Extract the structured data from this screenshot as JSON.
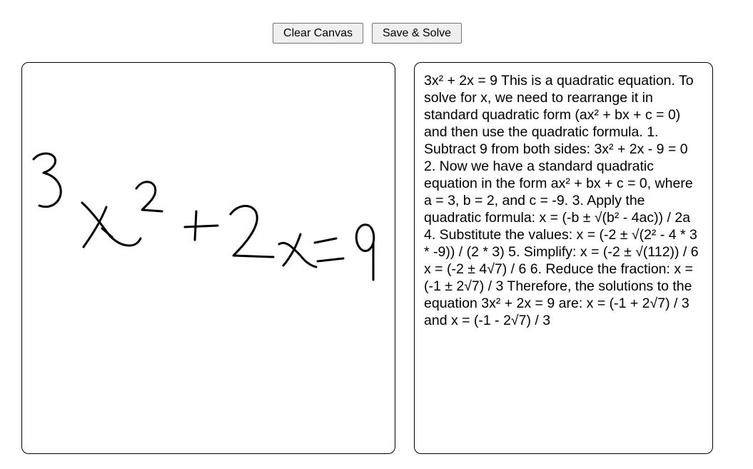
{
  "toolbar": {
    "clear_label": "Clear Canvas",
    "save_label": "Save & Solve"
  },
  "canvas": {
    "stroke_color": "#000000"
  },
  "result": {
    "text": "3x² + 2x = 9 This is a quadratic equation. To solve for x, we need to rearrange it in standard quadratic form (ax² + bx + c = 0) and then use the quadratic formula. 1. Subtract 9 from both sides: 3x² + 2x - 9 = 0 2. Now we have a standard quadratic equation in the form ax² + bx + c = 0, where a = 3, b = 2, and c = -9. 3. Apply the quadratic formula: x = (-b ± √(b² - 4ac)) / 2a 4. Substitute the values: x = (-2 ± √(2² - 4 * 3 * -9)) / (2 * 3) 5. Simplify: x = (-2 ± √(112)) / 6 x = (-2 ± 4√7) / 6 6. Reduce the fraction: x = (-1 ± 2√7) / 3 Therefore, the solutions to the equation 3x² + 2x = 9 are: x = (-1 + 2√7) / 3 and x = (-1 - 2√7) / 3"
  }
}
